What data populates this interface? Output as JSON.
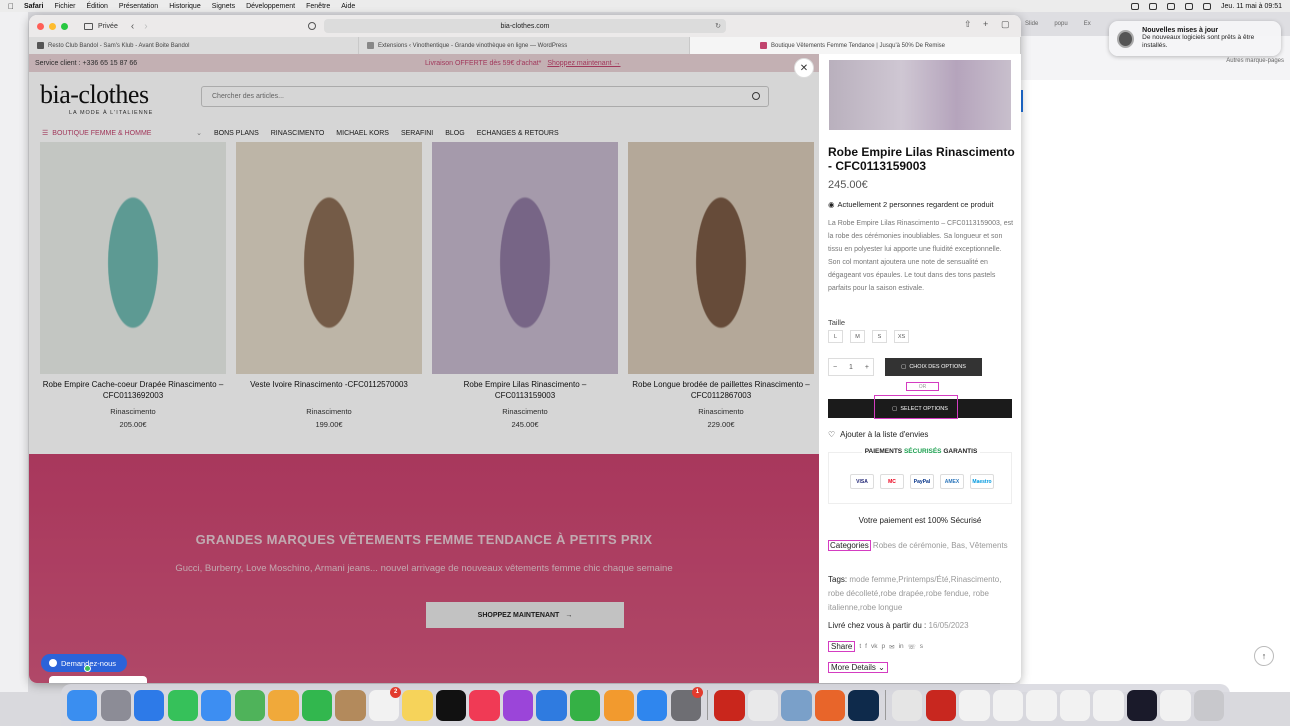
{
  "menubar": {
    "app": "Safari",
    "items": [
      "Fichier",
      "Édition",
      "Présentation",
      "Historique",
      "Signets",
      "Développement",
      "Fenêtre",
      "Aide"
    ],
    "clock": "Jeu. 11 mai à 09:51"
  },
  "notification": {
    "title": "Nouvelles mises à jour",
    "body": "De nouveaux logiciels sont prêts à être installés."
  },
  "bg_window": {
    "tabs": [
      "Slide",
      "popu",
      "Ex"
    ],
    "bookmarks": "Autres marque-pages"
  },
  "browser": {
    "private_label": "Privée",
    "url": "bia-clothes.com",
    "tabs": [
      {
        "label": "Resto Club Bandol - Sam's Klub - Avant Boite Bandol"
      },
      {
        "label": "Extensions ‹ Vinothentique - Grande vinothèque en ligne — WordPress"
      },
      {
        "label": "Boutique Vêtements Femme Tendance | Jusqu'à 50% De Remise"
      }
    ]
  },
  "site": {
    "service_client": "Service client : +336 65 15 87 66",
    "promo_text": "Livraison OFFERTE dès 59€ d'achat*",
    "promo_link": "Shoppez maintenant →",
    "logo": "bia-clothes",
    "logo_tagline": "LA MODE À L'ITALIENNE",
    "search_placeholder": "Chercher des articles...",
    "category_menu": "BOUTIQUE FEMME & HOMME",
    "nav": [
      "BONS PLANS",
      "RINASCIMENTO",
      "MICHAEL KORS",
      "SERAFINI",
      "BLOG",
      "ECHANGES & RETOURS"
    ]
  },
  "products": [
    {
      "name": "Robe Empire Cache-coeur Drapée Rinascimento – CFC0113692003",
      "brand": "Rinascimento",
      "price": "205.00€",
      "c1": "#e9ece8",
      "c2": "#6fb8b0"
    },
    {
      "name": "Veste Ivoire Rinascimento -CFC0112570003",
      "brand": "Rinascimento",
      "price": "199.00€",
      "c1": "#e2d8c7",
      "c2": "#8b6d55"
    },
    {
      "name": "Robe Empire Lilas Rinascimento – CFC0113159003",
      "brand": "Rinascimento",
      "price": "245.00€",
      "c1": "#c5b8cc",
      "c2": "#8e79a0"
    },
    {
      "name": "Robe Longue brodée de paillettes Rinascimento – CFC0112867003",
      "brand": "Rinascimento",
      "price": "229.00€",
      "c1": "#d7c9b7",
      "c2": "#7a5a44"
    }
  ],
  "hero": {
    "title": "GRANDES MARQUES VÊTEMENTS FEMME TENDANCE À PETITS PRIX",
    "subtitle": "Gucci, Burberry, Love Moschino, Armani jeans... nouvel arrivage de nouveaux vêtements femme chic chaque semaine",
    "button": "SHOPPEZ MAINTENANT"
  },
  "chat": {
    "label": "Demandez-nous"
  },
  "quickview": {
    "title": "Robe Empire Lilas Rinascimento - CFC0113159003",
    "price": "245.00€",
    "watching": "Actuellement 2 personnes regardent ce produit",
    "description": "La Robe Empire Lilas Rinascimento – CFC0113159003, est la robe des cérémonies inoubliables. Sa longueur et son tissu en polyester lui apporte une fluidité exceptionnelle. Son col montant ajoutera une note de sensualité en dégageant vos épaules. Le tout dans des tons pastels parfaits pour la saison estivale.",
    "size_label": "Taille",
    "sizes": [
      "L",
      "M",
      "S",
      "XS"
    ],
    "qty": "1",
    "choice_button": "CHOIX DES OPTIONS",
    "or_label": "OR",
    "select_button": "SELECT OPTIONS",
    "wishlist": "Ajouter à la liste d'envies",
    "payment_title_a": "PAIEMENTS",
    "payment_title_b": "SÉCURISÉS",
    "payment_title_c": "GARANTIS",
    "cards": [
      "VISA",
      "MC",
      "PayPal",
      "AMEX",
      "Maestro"
    ],
    "secure_note": "Votre paiement est 100% Sécurisé",
    "categories_label": "Categories",
    "categories_value": "Robes de cérémonie, Bas, Vêtements",
    "tags_label": "Tags:",
    "tags_value": "mode femme,Printemps/Été,Rinascimento, robe décolleté,robe drapée,robe fendue, robe italienne,robe longue",
    "delivery_label": "Livré chez vous à partir du :",
    "delivery_date": "16/05/2023",
    "share_label": "Share",
    "more_details": "More Details"
  },
  "dock": [
    {
      "name": "Finder",
      "color": "#3a8ef0"
    },
    {
      "name": "Launchpad",
      "color": "#8c8c96"
    },
    {
      "name": "Safari",
      "color": "#2d7ae8"
    },
    {
      "name": "Messages",
      "color": "#36c15a"
    },
    {
      "name": "Mail",
      "color": "#3d8ef2"
    },
    {
      "name": "Plans",
      "color": "#4fb35a"
    },
    {
      "name": "Photos",
      "color": "#f0a93a"
    },
    {
      "name": "FaceTime",
      "color": "#32b74e"
    },
    {
      "name": "Contacts",
      "color": "#b38a5c"
    },
    {
      "name": "Rappels",
      "color": "#f2f2f2",
      "badge": "2"
    },
    {
      "name": "Notes",
      "color": "#f6d35a"
    },
    {
      "name": "TV",
      "color": "#111111"
    },
    {
      "name": "Musique",
      "color": "#f03a55"
    },
    {
      "name": "Podcasts",
      "color": "#9b45d9"
    },
    {
      "name": "Keynote",
      "color": "#2f7be0"
    },
    {
      "name": "Numbers",
      "color": "#35b145"
    },
    {
      "name": "Pages",
      "color": "#f29a2e"
    },
    {
      "name": "App Store",
      "color": "#2f86ee"
    },
    {
      "name": "Réglages",
      "color": "#6e6e73",
      "badge": "1"
    },
    {
      "name": "FileZilla",
      "color": "#c9261c"
    },
    {
      "name": "TextEdit",
      "color": "#e9e9ea"
    },
    {
      "name": "Aperçu",
      "color": "#7aa0c9"
    },
    {
      "name": "Firefox",
      "color": "#e8652a"
    },
    {
      "name": "Photoshop",
      "color": "#0e2a4b"
    },
    {
      "name": "Doc",
      "color": "#e5e5e5"
    },
    {
      "name": "Acrobat",
      "color": "#c8271f"
    },
    {
      "name": "Fichier 1",
      "color": "#f2f2f2"
    },
    {
      "name": "Fichier 2",
      "color": "#f2f2f2"
    },
    {
      "name": "Fichier 3",
      "color": "#f2f2f2"
    },
    {
      "name": "Fichier 4",
      "color": "#f2f2f2"
    },
    {
      "name": "Fichier 5",
      "color": "#f2f2f2"
    },
    {
      "name": "Fichier 6",
      "color": "#1a1a2a"
    },
    {
      "name": "Fichier 7",
      "color": "#f2f2f2"
    },
    {
      "name": "Corbeille",
      "color": "#c8c8cc"
    }
  ]
}
